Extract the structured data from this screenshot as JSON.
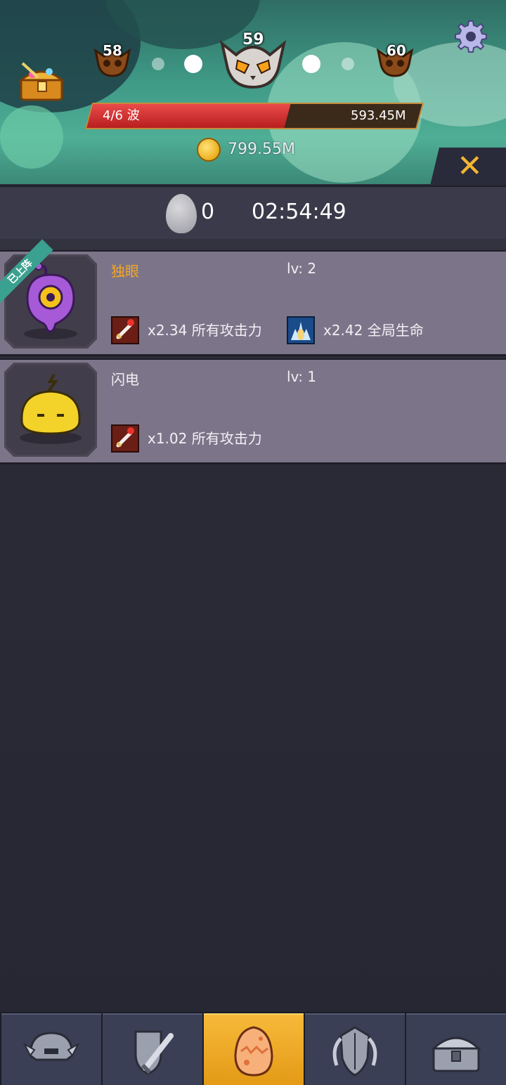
{
  "header": {
    "waves": {
      "prev": "58",
      "current": "59",
      "next": "60"
    },
    "hp": {
      "wave_label": "4/6 波",
      "value": "593.45M",
      "fill_fraction": 0.6
    },
    "gold": "799.55M",
    "close_label": "✕"
  },
  "summary": {
    "egg_count": "0",
    "timer": "02:54:49"
  },
  "pets": [
    {
      "name": "独眼",
      "name_color": "#f5a623",
      "level": "lv: 2",
      "deployed_label": "已上阵",
      "buffs": [
        {
          "icon": "sword-icon",
          "text": "x2.34 所有攻击力"
        },
        {
          "icon": "health-aura-icon",
          "text": "x2.42 全局生命"
        }
      ]
    },
    {
      "name": "闪电",
      "name_color": "#f0eef4",
      "level": "lv: 1",
      "buffs": [
        {
          "icon": "sword-icon",
          "text": "x1.02 所有攻击力"
        }
      ]
    }
  ],
  "nav": {
    "tabs": [
      {
        "icon": "helmet-icon",
        "active": false
      },
      {
        "icon": "shield-sword-icon",
        "active": false
      },
      {
        "icon": "egg-icon",
        "active": true
      },
      {
        "icon": "armor-icon",
        "active": false
      },
      {
        "icon": "treasure-chest-icon",
        "active": false
      }
    ]
  }
}
